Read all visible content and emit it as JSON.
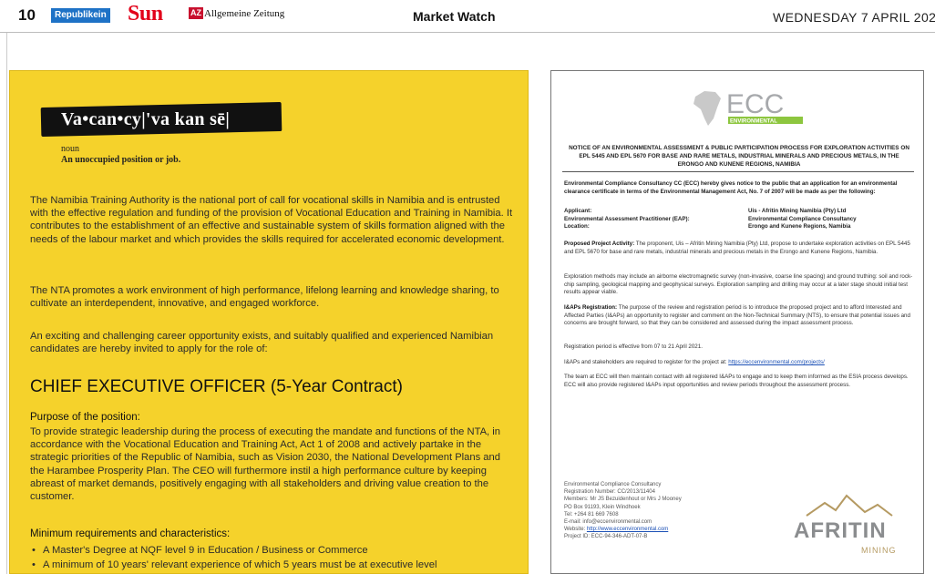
{
  "header": {
    "page_number": "10",
    "logos": [
      "Republikein",
      "Sun",
      "AZ",
      "Allgemeine Zeitung"
    ],
    "section": "Market Watch",
    "date": "WEDNESDAY 7 APRIL 202"
  },
  "nta_ad": {
    "headline": "Va•can•cy|'va kan sē|",
    "pos": "noun",
    "definition": "An unoccupied position or job.",
    "paragraphs": [
      "The Namibia Training Authority is the national port of call for vocational skills in Namibia and is entrusted with the effective regulation and funding of the provision of Vocational Education and Training in Namibia. It contributes to the establishment of an effective and sustainable system of skills formation aligned with the needs of the labour market and which provides the skills required for accelerated economic development.",
      "The NTA promotes a work environment of high performance, lifelong learning and knowledge sharing, to cultivate an interdependent, innovative, and engaged workforce.",
      "An exciting and challenging career opportunity exists, and suitably qualified and experienced Namibian candidates are hereby invited to apply for the role of:"
    ],
    "position_title": "CHIEF EXECUTIVE OFFICER (5-Year Contract)",
    "purpose_heading": "Purpose of the position:",
    "purpose_text": "To provide strategic leadership during the process of executing the mandate and functions of the NTA, in accordance with the Vocational Education and Training Act, Act 1 of 2008 and actively partake in the strategic priorities of the Republic of Namibia, such as Vision 2030, the National Development Plans and the Harambee Prosperity Plan. The CEO will furthermore instil a high performance culture by keeping abreast of market demands, positively engaging with all stakeholders and driving value creation to the customer.",
    "requirements_heading": "Minimum requirements and characteristics:",
    "requirements": [
      "A Master's Degree at NQF level 9 in Education / Business or Commerce",
      "A minimum of 10 years' relevant experience of which 5 years must be at executive level"
    ]
  },
  "ecc_notice": {
    "logo_text": "ECC",
    "logo_sub": "ENVIRONMENTAL",
    "title": "NOTICE OF AN ENVIRONMENTAL ASSESSMENT & PUBLIC PARTICIPATION PROCESS FOR EXPLORATION ACTIVITIES ON EPL 5445 AND EPL 5670 FOR BASE AND RARE METALS, INDUSTRIAL MINERALS AND PRECIOUS METALS, IN THE ERONGO AND KUNENE REGIONS, NAMIBIA",
    "intro": "Environmental Compliance Consultancy CC (ECC) hereby gives notice to the public that an application for an environmental clearance certificate in terms of the Environmental Management Act, No. 7 of 2007 will be made as per the following:",
    "details": [
      {
        "label": "Applicant:",
        "value": "Uis - Afritin Mining Namibia (Pty) Ltd"
      },
      {
        "label": "Environmental Assessment Practitioner (EAP):",
        "value": "Environmental Compliance Consultancy"
      },
      {
        "label": "Location:",
        "value": "Erongo and Kunene Regions, Namibia"
      }
    ],
    "activity_label": "Proposed Project Activity:",
    "activity_text": "The proponent, Uis – Afritin Mining Namibia (Pty) Ltd, propose to undertake exploration activities on EPL 5445 and EPL 5670 for base and rare metals, industrial minerals and precious metals in the Erongo and Kunene Regions, Namibia.",
    "methods_text": "Exploration methods may include an airborne electromagnetic survey (non-invasive, coarse line spacing) and ground truthing: soil and rock-chip sampling, geological mapping and geophysical surveys. Exploration sampling and drilling may occur at a later stage should initial test results appear viable.",
    "registration_label": "I&APs Registration:",
    "registration_text": "The purpose of the review and registration period is to introduce the proposed project and to afford Interested and Affected Parties (I&APs) an opportunity to register and comment on the Non-Technical Summary (NTS), to ensure that potential issues and concerns are brought forward, so that they can be considered and assessed during the impact assessment process.",
    "period_text": "Registration period is effective from 07 to 21 April 2021.",
    "register_text": "I&APs and stakeholders are required to register for the project at:",
    "register_link": "https://eccenvironmental.com/projects/",
    "closing_text": "The team at ECC will then maintain contact with all registered I&APs to engage and to keep them informed as the ESIA process develops. ECC will also provide registered I&APs input opportunities and review periods throughout the assessment process.",
    "footer_lines": [
      "Environmental Compliance Consultancy",
      "Registration Number: CC/2013/11404",
      "Members: Mr JS Bezuidenhout or Mrs J Mooney",
      "PO Box 91193, Klein Windhoek",
      "Tel: +264 81 669 7608",
      "E-mail: info@eccenvironmental.com"
    ],
    "footer_website_label": "Website:",
    "footer_website": "http://www.eccenvironmental.com",
    "footer_project": "Project ID: ECC-94-346-ADT-07-B",
    "afritin_name": "AFRITIN",
    "afritin_sub": "MINING"
  },
  "colors": {
    "ad_yellow": "#f5d22b",
    "republikein_blue": "#1e72c6",
    "sun_red": "#e2001a",
    "ecc_green": "#8dc63f",
    "afritin_gold": "#b59a62"
  }
}
